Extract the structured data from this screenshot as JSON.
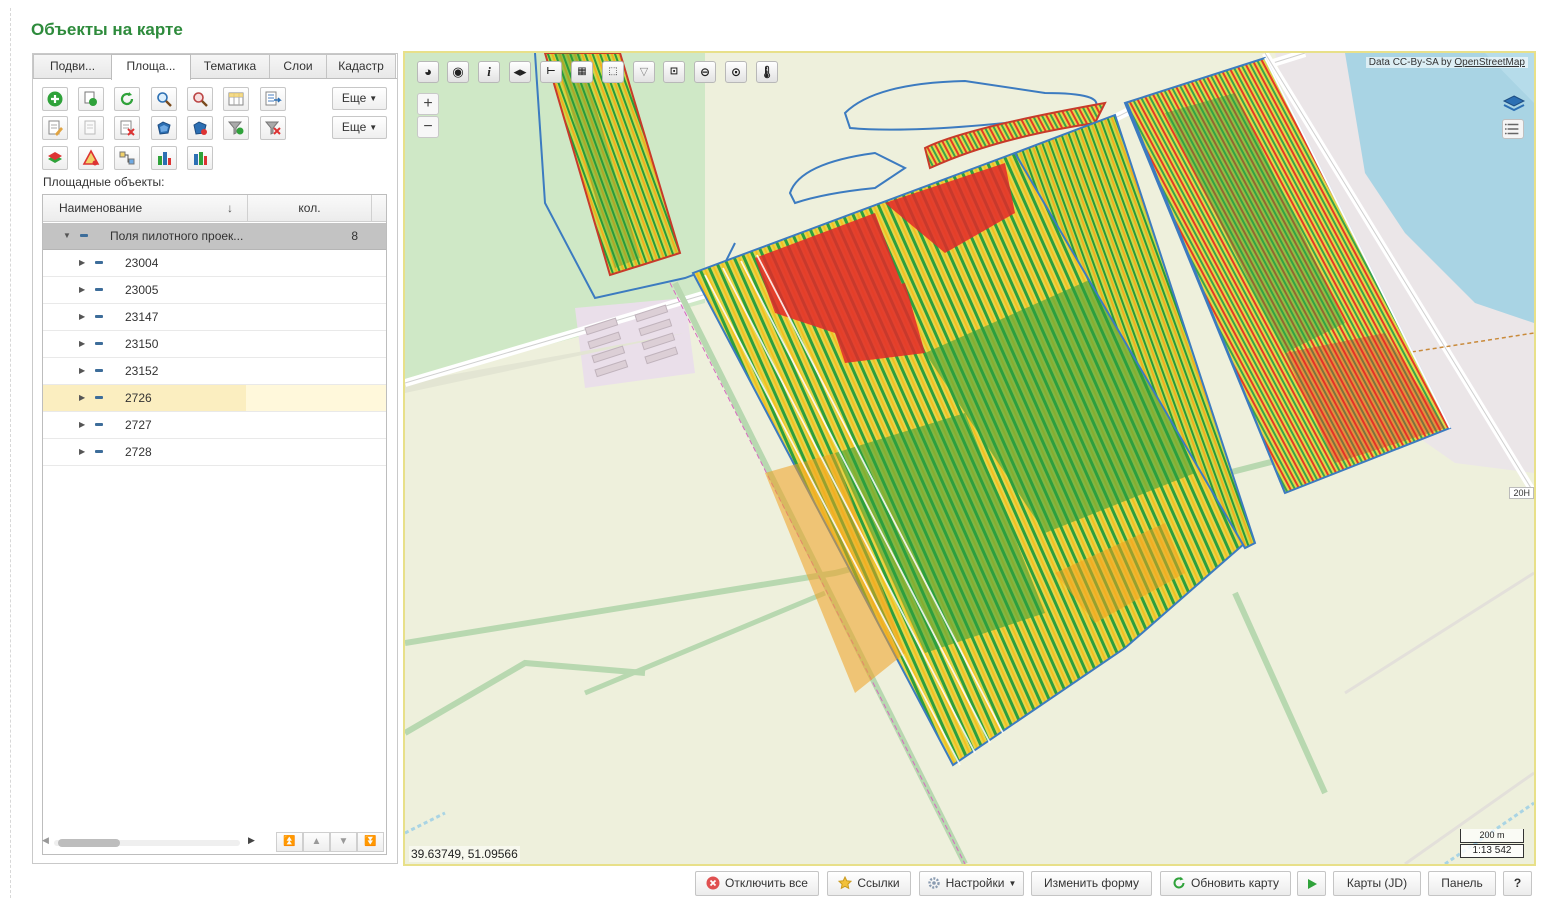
{
  "page": {
    "title": "Объекты на карте"
  },
  "tabs": [
    {
      "label": "Подви..."
    },
    {
      "label": "Площа..."
    },
    {
      "label": "Тематика"
    },
    {
      "label": "Слои"
    },
    {
      "label": "Кадастр"
    }
  ],
  "toolbar": {
    "more_label_1": "Еще",
    "more_label_2": "Еще"
  },
  "section_label": "Площадные объекты:",
  "grid": {
    "col_name": "Наименование",
    "col_count": "кол.",
    "sort_glyph": "↓",
    "group": {
      "label": "Поля пилотного проек...",
      "count": "8"
    },
    "rows": [
      {
        "label": "23004"
      },
      {
        "label": "23005"
      },
      {
        "label": "23147"
      },
      {
        "label": "23150"
      },
      {
        "label": "23152"
      },
      {
        "label": "2726"
      },
      {
        "label": "2727"
      },
      {
        "label": "2728"
      }
    ]
  },
  "map": {
    "attribution_prefix": "Data CC-By-SA by ",
    "attribution_link": "OpenStreetMap",
    "coords": "39.63749, 51.09566",
    "scale_distance": "200 m",
    "scale_ratio": "1:13 542",
    "road_label": "20Н",
    "zoom_in": "+",
    "zoom_out": "−"
  },
  "bottom_buttons": {
    "disable_all": "Отключить все",
    "links": "Ссылки",
    "settings": "Настройки",
    "change_form": "Изменить форму",
    "refresh_map": "Обновить карту",
    "maps_jd": "Карты (JD)",
    "panel": "Панель",
    "help": "?"
  },
  "colors": {
    "title_green": "#2e8b3c",
    "selected_row": "#fbeec0",
    "map_frame": "#e8e089"
  }
}
